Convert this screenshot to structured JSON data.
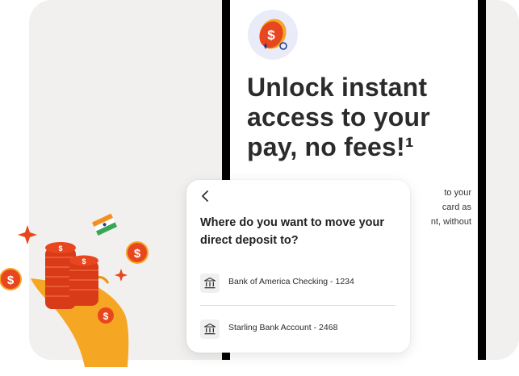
{
  "promo": {
    "headline": "Unlock instant access to your pay, no fees!¹",
    "body_line_1": "to your",
    "body_line_2": "card as",
    "body_line_3": "nt, without"
  },
  "sheet": {
    "title": "Where do you want to move your direct deposit to?",
    "accounts": [
      {
        "label": "Bank of America Checking - 1234"
      },
      {
        "label": "Starling Bank Account - 2468"
      }
    ]
  },
  "icons": {
    "back": "chevron-left-icon",
    "bank": "bank-icon",
    "coin": "dollar-coin-icon"
  },
  "colors": {
    "accent_orange": "#e8461e",
    "coin_yellow": "#f5a623",
    "headline": "#2b2b2b"
  }
}
